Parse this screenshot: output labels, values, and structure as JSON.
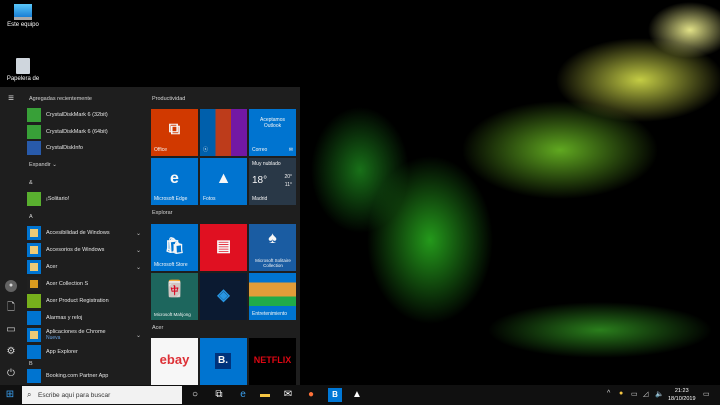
{
  "desktop": {
    "icons": [
      {
        "label": "Este equipo"
      },
      {
        "label": "Papelera de"
      }
    ]
  },
  "start_menu": {
    "recent_header": "Agregadas recientemente",
    "recent": [
      {
        "label": "CrystalDiskMark 6 (32bit)"
      },
      {
        "label": "CrystalDiskMark 6 (64bit)"
      },
      {
        "label": "CrystalDiskInfo"
      }
    ],
    "expand": "Expandir",
    "sections": [
      {
        "letter": "&",
        "items": [
          {
            "label": "¡Solitario!"
          }
        ]
      },
      {
        "letter": "A",
        "items": [
          {
            "label": "Accesibilidad de Windows",
            "folder": true
          },
          {
            "label": "Accesorios de Windows",
            "folder": true
          },
          {
            "label": "Acer",
            "folder": true
          },
          {
            "label": "Acer Collection S"
          },
          {
            "label": "Acer Product Registration"
          },
          {
            "label": "Alarmas y reloj"
          },
          {
            "label": "Aplicaciones de Chrome",
            "folder": true,
            "badge": "Nueva"
          },
          {
            "label": "App Explorer"
          }
        ]
      },
      {
        "letter": "B",
        "items": [
          {
            "label": "Booking.com Partner App"
          }
        ]
      }
    ],
    "tile_groups": [
      {
        "title": "Productividad",
        "tiles": [
          {
            "label": "Office",
            "color": "#d83b01",
            "glyph": "⧉"
          },
          {
            "label": "",
            "color": "#0078d7",
            "glyph": ""
          },
          {
            "label": "Correo",
            "color": "#0078d7",
            "glyph": "Aceptamos Outlook"
          },
          {
            "label": "Microsoft Edge",
            "color": "#0078d7",
            "glyph": "e"
          },
          {
            "label": "Fotos",
            "color": "#0078d7",
            "glyph": "▲"
          },
          {
            "label": "Madrid",
            "color": "#2b3a4a",
            "weather": {
              "cond": "Muy nublado",
              "temp": "18°",
              "hi": "20°",
              "lo": "11°"
            }
          }
        ]
      },
      {
        "title": "Explorar",
        "tiles": [
          {
            "label": "Microsoft Store",
            "color": "#0078d7",
            "glyph": "🛍"
          },
          {
            "label": "",
            "color": "#e81123",
            "glyph": "▤"
          },
          {
            "label": "Microsoft Solitaire Collection",
            "color": "#1b5fa8",
            "glyph": "♠"
          },
          {
            "label": "Microsoft Mahjong",
            "color": "#1e6a60",
            "glyph": "🀄"
          },
          {
            "label": "",
            "color": "#0c1b33",
            "glyph": "◈"
          },
          {
            "label": "Entretenimiento",
            "color": "#0078d7",
            "glyph": ""
          }
        ]
      },
      {
        "title": "Acer",
        "tiles": [
          {
            "label": "",
            "color": "#ffffff",
            "glyph": "ebay"
          },
          {
            "label": "",
            "color": "#0078d7",
            "glyph": "B."
          },
          {
            "label": "",
            "color": "#000000",
            "glyph": "NETFLIX"
          }
        ]
      }
    ]
  },
  "taskbar": {
    "search_placeholder": "Escribe aquí para buscar",
    "time": "21:23",
    "date": "18/10/2019"
  }
}
